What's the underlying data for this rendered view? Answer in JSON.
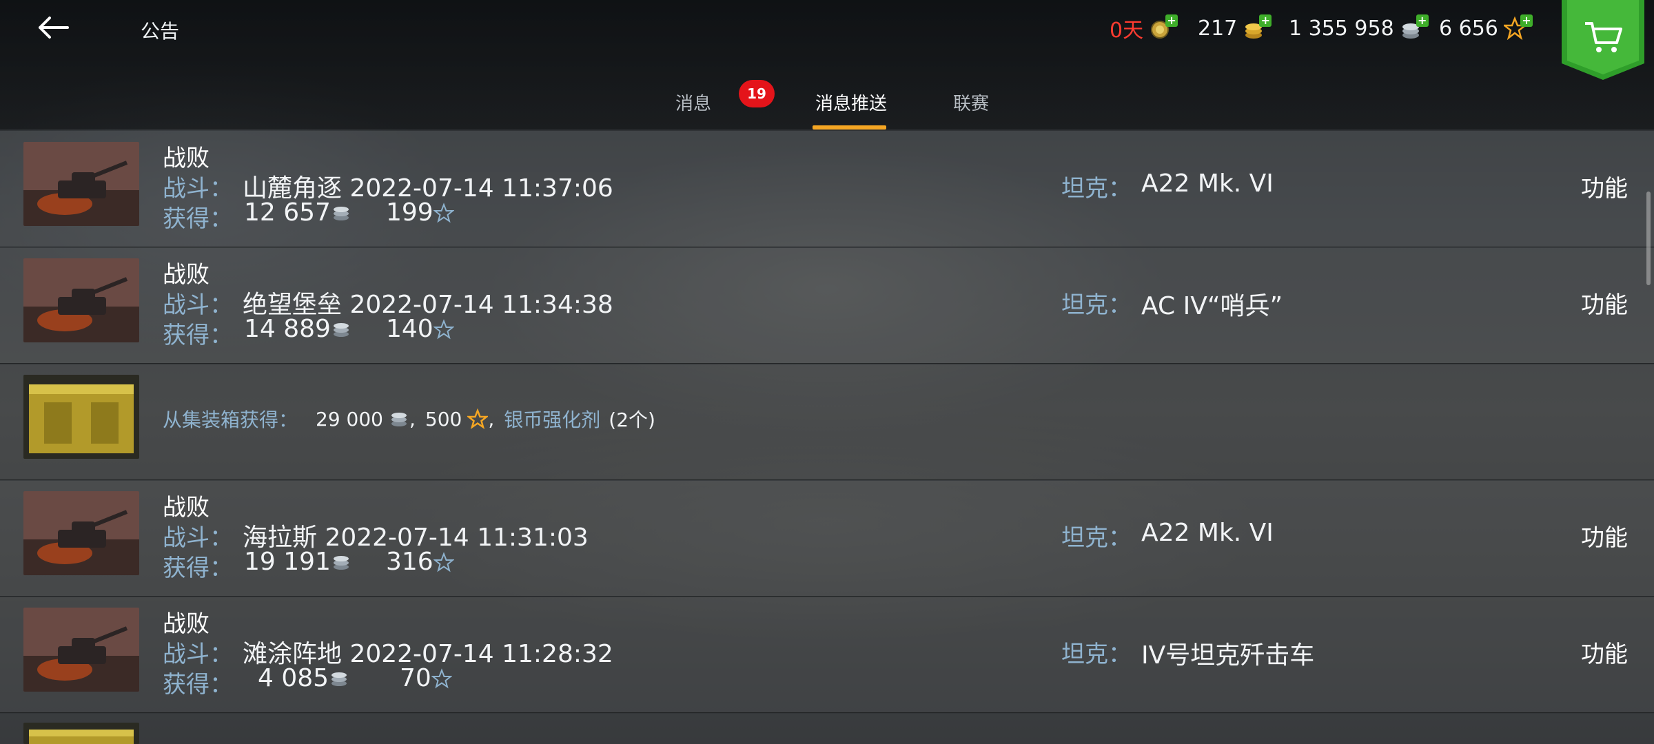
{
  "header": {
    "title": "公告",
    "premium_days": "0天",
    "gold": "217",
    "silver": "1 355 958",
    "free_xp": "6 656"
  },
  "tabs": [
    {
      "label": "消息",
      "badge": "19"
    },
    {
      "label": "消息推送",
      "active": true
    },
    {
      "label": "联赛"
    }
  ],
  "labels": {
    "battle": "战斗：",
    "earned": "获得：",
    "tank": "坦克：",
    "function": "功能"
  },
  "rows": [
    {
      "type": "battle",
      "result": "战败",
      "map_time": "山麓角逐 2022-07-14 11:37:06",
      "silver": "12 657",
      "xp": "199",
      "tank": "A22 Mk. VI"
    },
    {
      "type": "battle",
      "result": "战败",
      "map_time": "绝望堡垒 2022-07-14 11:34:38",
      "silver": "14 889",
      "xp": "140",
      "tank": "AC IV“哨兵”"
    },
    {
      "type": "container",
      "text": "从集装箱获得：",
      "silver": "29 000",
      "xp": "500",
      "item": "银币强化剂",
      "count": "(2个)"
    },
    {
      "type": "battle",
      "result": "战败",
      "map_time": "海拉斯 2022-07-14 11:31:03",
      "silver": "19 191",
      "xp": "316",
      "tank": "A22 Mk. VI"
    },
    {
      "type": "battle",
      "result": "战败",
      "map_time": "滩涂阵地 2022-07-14 11:28:32",
      "silver": "4 085",
      "xp": "70",
      "tank": "IV号坦克歼击车"
    }
  ],
  "colors": {
    "accent": "#f5a623",
    "badge": "#e4141a",
    "label": "#8fb3cf",
    "premium": "#ff3b30",
    "plus": "#3fae2a"
  }
}
